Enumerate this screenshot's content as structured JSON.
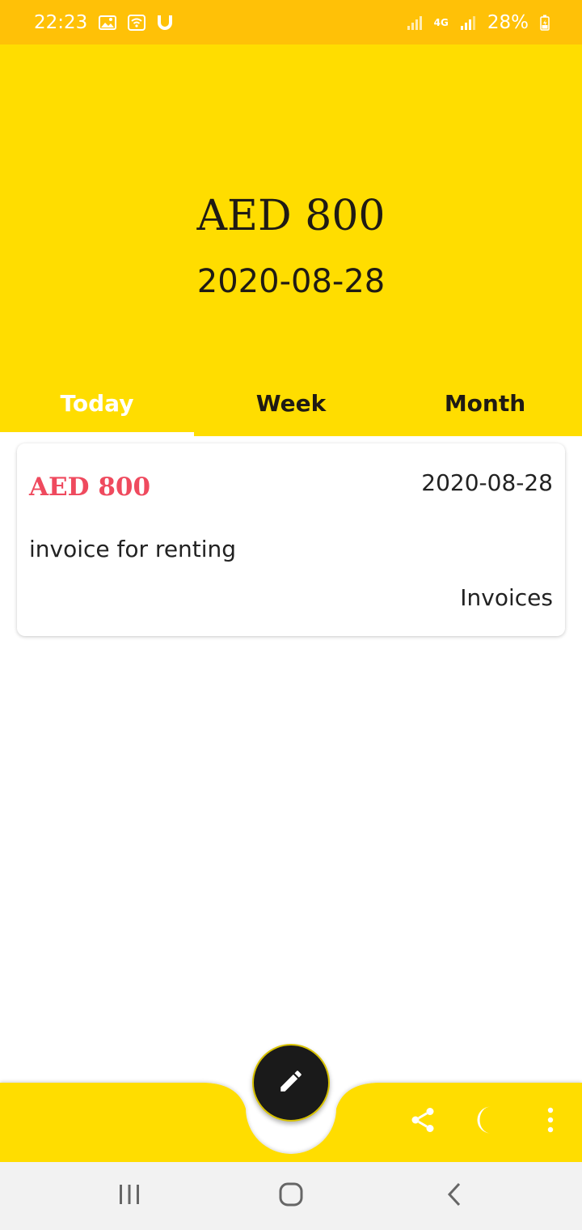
{
  "status_bar": {
    "time": "22:23",
    "battery": "28%",
    "network": "4G",
    "icons": [
      "gallery-icon",
      "wifi-icon",
      "magnet-icon",
      "signal-icon",
      "signal-icon",
      "battery-charging-icon"
    ]
  },
  "header": {
    "total_amount": "AED 800",
    "date": "2020-08-28"
  },
  "tabs": [
    {
      "label": "Today",
      "active": true
    },
    {
      "label": "Week",
      "active": false
    },
    {
      "label": "Month",
      "active": false
    }
  ],
  "entries": [
    {
      "amount": "AED 800",
      "date": "2020-08-28",
      "description": "invoice for renting",
      "category": "Invoices"
    }
  ],
  "bottom_bar": {
    "fab_icon": "pencil-icon",
    "actions": [
      "share-icon",
      "moon-icon",
      "more-vertical-icon"
    ]
  },
  "nav_bar": {
    "buttons": [
      "recent-apps-icon",
      "home-icon",
      "back-icon"
    ]
  },
  "colors": {
    "header": "#FFDD00",
    "status_bar": "#FFC107",
    "amount_accent": "#EF4A5E",
    "fab": "#1a1a1a"
  }
}
